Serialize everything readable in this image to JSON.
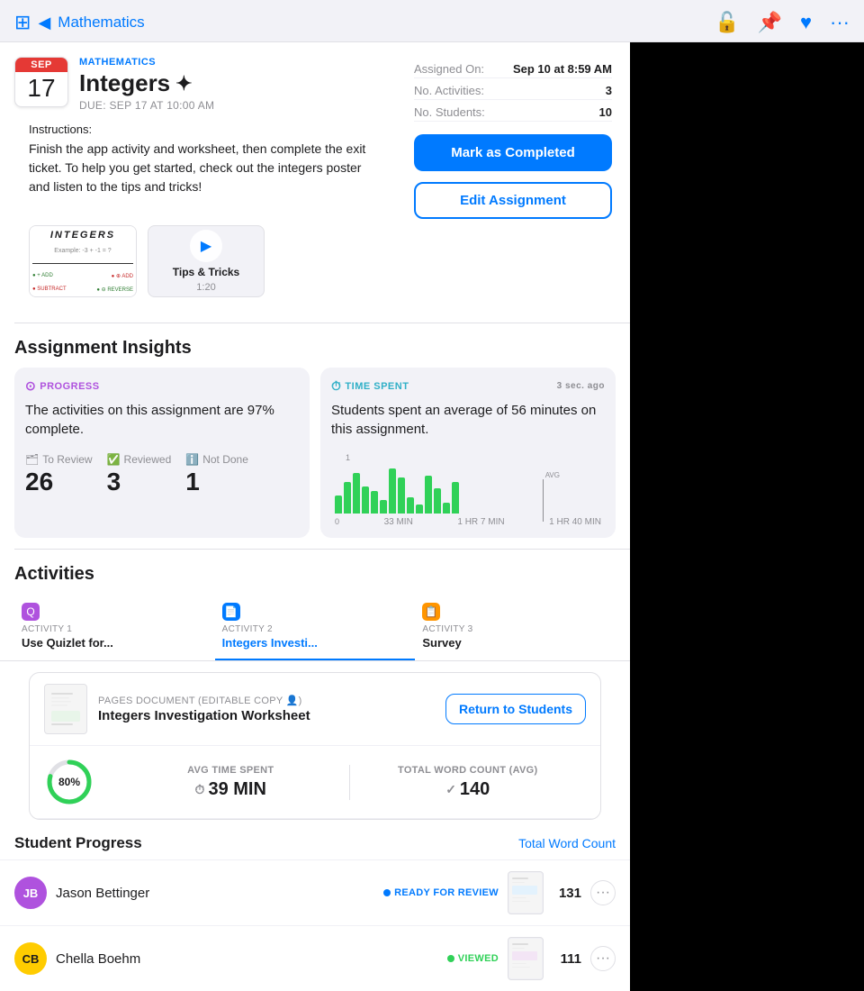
{
  "nav": {
    "back_icon": "◀",
    "back_label": "Mathematics",
    "sidebar_icon": "⊞",
    "icons": [
      "🔓",
      "📌",
      "♥",
      "···"
    ]
  },
  "header": {
    "calendar": {
      "month": "SEP",
      "day": "17"
    },
    "subject": "MATHEMATICS",
    "title": "Integers",
    "sparkle": "✦",
    "due": "DUE: SEP 17 AT 10:00 AM",
    "assigned_on_label": "Assigned On:",
    "assigned_on_value": "Sep 10 at 8:59 AM",
    "no_activities_label": "No. Activities:",
    "no_activities_value": "3",
    "no_students_label": "No. Students:",
    "no_students_value": "10"
  },
  "buttons": {
    "mark_completed": "Mark as Completed",
    "edit_assignment": "Edit Assignment"
  },
  "instructions": {
    "label": "Instructions:",
    "text": "Finish the app activity and worksheet, then complete the exit ticket. To help you get started, check out the integers poster and listen to the tips and tricks!"
  },
  "attachments": {
    "poster_title": "INTEGERS",
    "video_title": "Tips & Tricks",
    "video_duration": "1:20"
  },
  "insights": {
    "section_title": "Assignment Insights",
    "progress_label": "PROGRESS",
    "progress_text": "The activities on this assignment are 97% complete.",
    "time_spent_label": "TIME SPENT",
    "time_spent_ago": "3 sec. ago",
    "time_spent_text": "Students spent an average of 56 minutes on this assignment.",
    "to_review_label": "To Review",
    "to_review_value": "26",
    "reviewed_label": "Reviewed",
    "reviewed_value": "3",
    "not_done_label": "Not Done",
    "not_done_value": "1",
    "chart_x_labels": [
      "33 MIN",
      "1 HR 7 MIN",
      "1 HR 40 MIN"
    ]
  },
  "activities": {
    "section_title": "Activities",
    "tabs": [
      {
        "number": "ACTIVITY 1",
        "name": "Use Quizlet for...",
        "icon_color": "purple"
      },
      {
        "number": "ACTIVITY 2",
        "name": "Integers Investi...",
        "icon_color": "blue"
      },
      {
        "number": "ACTIVITY 3",
        "name": "Survey",
        "icon_color": "orange"
      }
    ],
    "doc": {
      "type": "PAGES DOCUMENT (EDITABLE COPY 👤)",
      "name": "Integers Investigation Worksheet",
      "return_btn": "Return to Students"
    },
    "avg_time_label": "AVG TIME SPENT",
    "avg_time_value": "39 MIN",
    "word_count_label": "TOTAL WORD COUNT (AVG)",
    "word_count_value": "140",
    "progress_pct": "80%"
  },
  "student_progress": {
    "title": "Student Progress",
    "link": "Total Word Count",
    "students": [
      {
        "initials": "JB",
        "name": "Jason Bettinger",
        "status": "READY FOR REVIEW",
        "status_type": "review",
        "count": "131"
      },
      {
        "initials": "CB",
        "name": "Chella Boehm",
        "status": "VIEWED",
        "status_type": "viewed",
        "count": "111"
      }
    ]
  }
}
